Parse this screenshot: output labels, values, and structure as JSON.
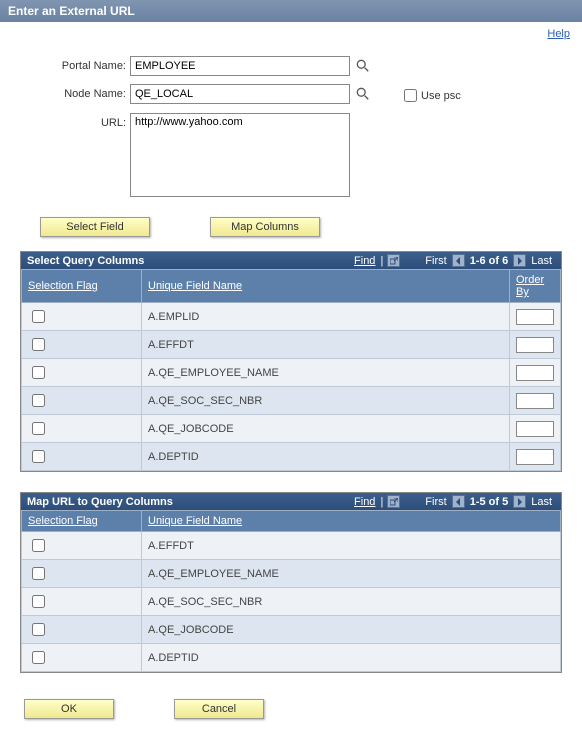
{
  "header": {
    "title": "Enter an External URL"
  },
  "help_label": "Help",
  "form": {
    "portal_label": "Portal Name:",
    "portal_value": "EMPLOYEE",
    "node_label": "Node Name:",
    "node_value": "QE_LOCAL",
    "use_psc_label": "Use psc",
    "url_label": "URL:",
    "url_value": "http://www.yahoo.com"
  },
  "buttons": {
    "select_field": "Select Field",
    "map_columns": "Map Columns",
    "ok": "OK",
    "cancel": "Cancel"
  },
  "grid1": {
    "title": "Select Query Columns",
    "find": "Find",
    "first": "First",
    "last": "Last",
    "range": "1-6 of 6",
    "col_sel": "Selection Flag",
    "col_field": "Unique Field Name",
    "col_order": "Order By",
    "rows": [
      {
        "field": "A.EMPLID"
      },
      {
        "field": "A.EFFDT"
      },
      {
        "field": "A.QE_EMPLOYEE_NAME"
      },
      {
        "field": "A.QE_SOC_SEC_NBR"
      },
      {
        "field": "A.QE_JOBCODE"
      },
      {
        "field": "A.DEPTID"
      }
    ]
  },
  "grid2": {
    "title": "Map URL to Query Columns",
    "find": "Find",
    "first": "First",
    "last": "Last",
    "range": "1-5 of 5",
    "col_sel": "Selection Flag",
    "col_field": "Unique Field Name",
    "rows": [
      {
        "field": "A.EFFDT"
      },
      {
        "field": "A.QE_EMPLOYEE_NAME"
      },
      {
        "field": "A.QE_SOC_SEC_NBR"
      },
      {
        "field": "A.QE_JOBCODE"
      },
      {
        "field": "A.DEPTID"
      }
    ]
  }
}
